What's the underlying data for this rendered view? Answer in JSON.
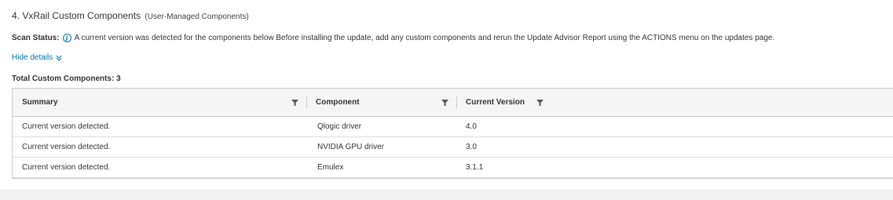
{
  "section": {
    "title": "4. VxRail Custom Components",
    "subtitle": "(User-Managed Components)"
  },
  "scan_status": {
    "label": "Scan Status:",
    "message": "A current version was detected for the components below Before installing the update, add any custom components and rerun the Update Advisor Report using the ACTIONS menu on the updates page."
  },
  "toggle": {
    "label": "Hide details"
  },
  "total": {
    "label": "Total Custom Components: 3"
  },
  "grid": {
    "columns": [
      "Summary",
      "Component",
      "Current Version"
    ],
    "rows": [
      {
        "summary": "Current version detected.",
        "component": "Qlogic driver",
        "version": "4.0"
      },
      {
        "summary": "Current version detected.",
        "component": "NVIDIA GPU driver",
        "version": "3.0"
      },
      {
        "summary": "Current version detected.",
        "component": "Emulex",
        "version": "3.1.1"
      }
    ]
  },
  "icons": {
    "info": "info-icon",
    "chevron": "double-chevron-down-icon",
    "filter": "filter-icon"
  },
  "colors": {
    "link": "#0072a3",
    "header_bg": "#f5f5f5",
    "border": "#cccccc"
  }
}
